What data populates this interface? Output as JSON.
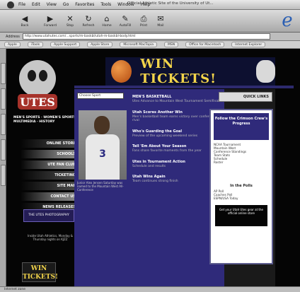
{
  "menubar": {
    "items": [
      "File",
      "Edit",
      "View",
      "Go",
      "Favorites",
      "Tools",
      "Window",
      "Help"
    ],
    "window_title": "Official Athletic Site of the University of Ut..."
  },
  "toolbar": {
    "back": "Back",
    "forward": "Forward",
    "stop": "Stop",
    "refresh": "Refresh",
    "home": "Home",
    "autofill": "AutoFill",
    "print": "Print",
    "mail": "Mail"
  },
  "address": {
    "label": "Address",
    "url": "http://www.utahutes.com/...sports/m-baskbl/utah-m-baskbl-body.html"
  },
  "favorites": [
    "Apple",
    "iTools",
    "Apple Support",
    "Apple Store",
    "Microsoft MacTopia",
    "MSN",
    "Office for Macintosh",
    "Internet Explorer"
  ],
  "banner": {
    "text": "WIN TICKETS!"
  },
  "logo": {
    "text": "UTES"
  },
  "center": {
    "search_placeholder": "Choose Sport",
    "caption": "Junior Alex Jensen Saturday was named to the Mountain West All-Conference",
    "articles": [
      {
        "headline": "MEN'S BASKETBALL",
        "text": "Utes Advance to Mountain West Tournament Semifinals"
      },
      {
        "headline": "Utah Scores Another Win",
        "text": "Men's basketball team earns victory over conference rival"
      },
      {
        "headline": "Who's Guarding the Goal",
        "text": "Preview of the upcoming weekend series"
      },
      {
        "headline": "Tell 'Em About Your Season",
        "text": "Fans share favorite moments from the year"
      },
      {
        "headline": "Utes in Tournament Action",
        "text": "Schedule and results"
      },
      {
        "headline": "Utah Wins Again",
        "text": "Team continues strong finish"
      }
    ]
  },
  "right": {
    "quick_links": "QUICK LINKS",
    "follow_title": "Follow the Crimson Crew's Progress",
    "follow_items": [
      "NCAA Tournament",
      "Mountain West",
      "Conference Standings",
      "Team Stats",
      "Schedule",
      "Roster"
    ],
    "polls_title": "In the Polls",
    "polls_items": [
      "AP Poll",
      "Coaches Poll",
      "ESPN/USA Today"
    ],
    "polls_box": "Get your Utah Utes gear at the official online store"
  },
  "nav": {
    "top_links": "MEN'S SPORTS · WOMEN'S SPORTS · MULTIMEDIA · HISTORY",
    "items": [
      "ONLINE STORE",
      "SCHOOLS",
      "UTE FAN CLUB",
      "TICKETING",
      "SITE MAP",
      "CONTACT US",
      "NEWS RELEASES"
    ],
    "promo": "THE UTES PHOTOGRAPHY",
    "small_text": "Inside Utah Athletics, Monday & Thursday nights on KJZZ"
  },
  "win_small": {
    "line1": "WIN",
    "line2": "TICKETS!"
  },
  "status": {
    "text": "Internet zone"
  }
}
